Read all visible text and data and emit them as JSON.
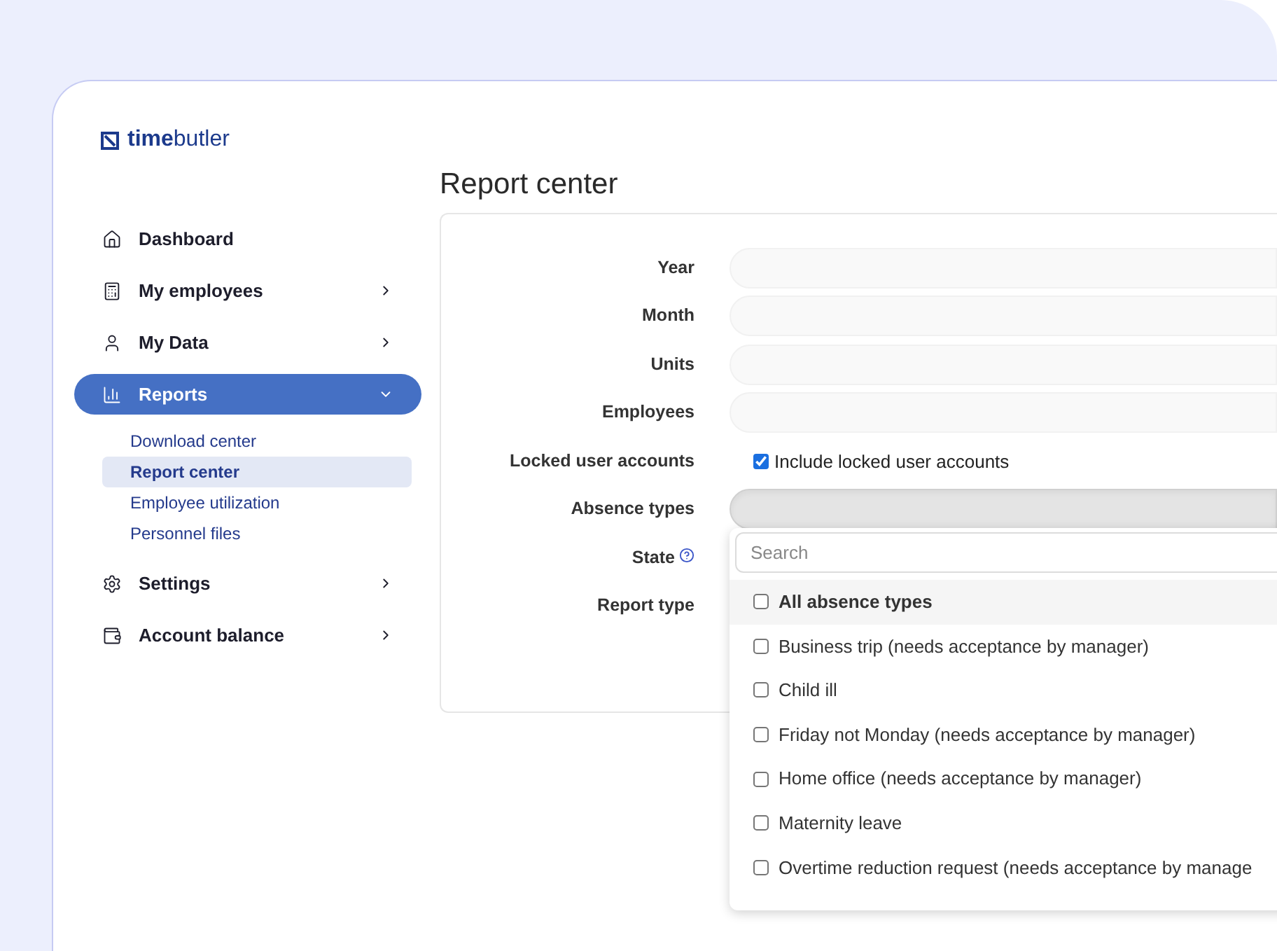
{
  "logo": {
    "bold": "time",
    "light": "butler"
  },
  "nav": [
    {
      "label": "Dashboard",
      "kind": "link",
      "selected": false
    },
    {
      "label": "My employees",
      "kind": "group",
      "expanded": false,
      "selected": false
    },
    {
      "label": "My Data",
      "kind": "group",
      "expanded": false,
      "selected": false
    },
    {
      "label": "Reports",
      "kind": "group",
      "expanded": true,
      "selected": true,
      "children": [
        {
          "label": "Download center",
          "selected": false
        },
        {
          "label": "Report center",
          "selected": true
        },
        {
          "label": "Employee utilization",
          "selected": false
        },
        {
          "label": "Personnel files",
          "selected": false
        }
      ]
    },
    {
      "label": "Settings",
      "kind": "group",
      "expanded": false,
      "selected": false
    },
    {
      "label": "Account balance",
      "kind": "group",
      "expanded": false,
      "selected": false
    }
  ],
  "page": {
    "title": "Report center"
  },
  "form": [
    {
      "label": "Year",
      "kind": "field"
    },
    {
      "label": "Month",
      "kind": "field"
    },
    {
      "label": "Units",
      "kind": "field"
    },
    {
      "label": "Employees",
      "kind": "field"
    },
    {
      "label": "Locked user accounts",
      "kind": "checkbox",
      "option": "Include locked user accounts",
      "checked": true
    },
    {
      "label": "Absence types",
      "kind": "select",
      "open": true
    },
    {
      "label": "State",
      "kind": "blank",
      "help": true
    },
    {
      "label": "Report type",
      "kind": "blank"
    }
  ],
  "dropdown": {
    "placeholder": "Search",
    "options": [
      {
        "label": "All absence types",
        "kind": "all",
        "checked": false
      },
      {
        "label": "Business trip (needs acceptance by manager)",
        "kind": "item",
        "checked": false
      },
      {
        "label": "Child ill",
        "kind": "item",
        "checked": false
      },
      {
        "label": "Friday not Monday (needs acceptance by manager)",
        "kind": "item",
        "checked": false
      },
      {
        "label": "Home office (needs acceptance by manager)",
        "kind": "item",
        "checked": false
      },
      {
        "label": "Maternity leave",
        "kind": "item",
        "checked": false
      },
      {
        "label": "Overtime reduction request (needs acceptance by manage",
        "kind": "item",
        "checked": false
      }
    ]
  }
}
